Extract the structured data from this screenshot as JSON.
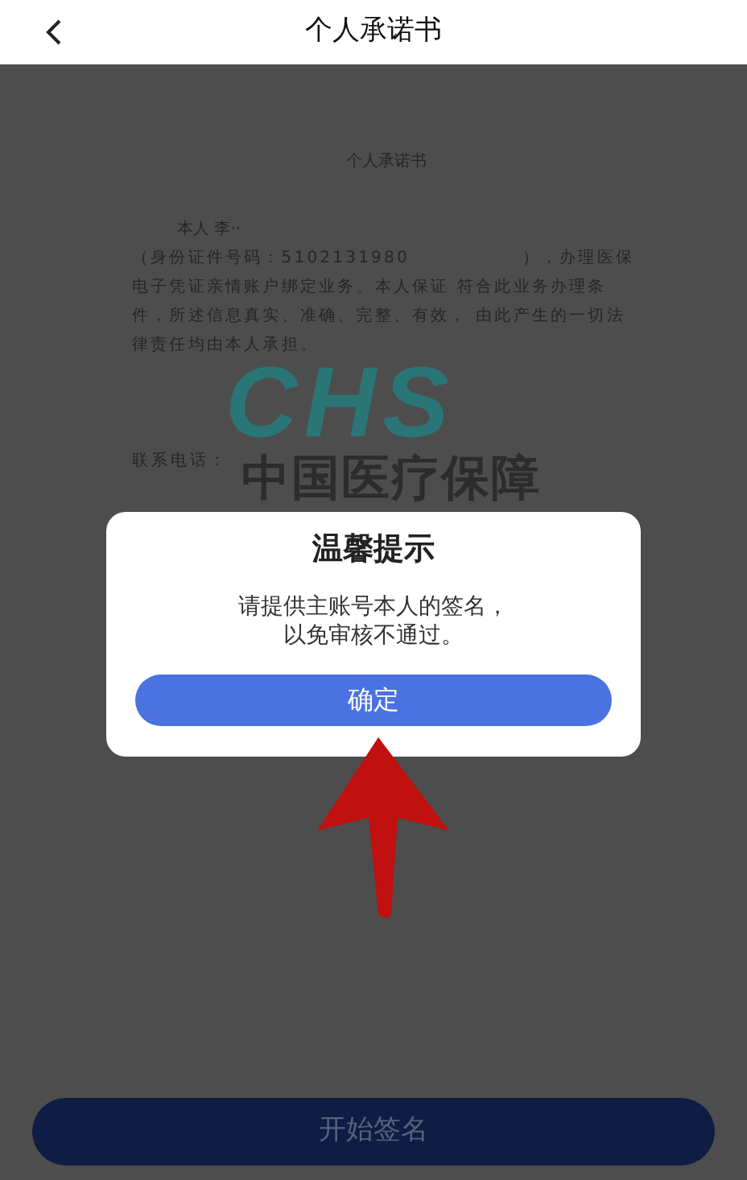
{
  "header": {
    "title": "个人承诺书"
  },
  "document": {
    "title": "个人承诺书",
    "signer": "本人 李··",
    "id_text": "（身份证件号码：5102131980",
    "body": "），办理医保电子凭证亲情账户绑定业务。本人保证 符合此业务办理条件，所述信息真实、准确、完整、有效， 由此产生的一切法律责任均由本人承担。",
    "logo_letters": "CHS",
    "logo_text": "中国医疗保障",
    "phone_label": "联系电话："
  },
  "dialog": {
    "title": "温馨提示",
    "message_lines": [
      "请提供主账号本人的签名，",
      "以免审核不通过。"
    ],
    "button": "确定"
  },
  "footer_button": {
    "label": "开始签名",
    "disabled": true
  }
}
